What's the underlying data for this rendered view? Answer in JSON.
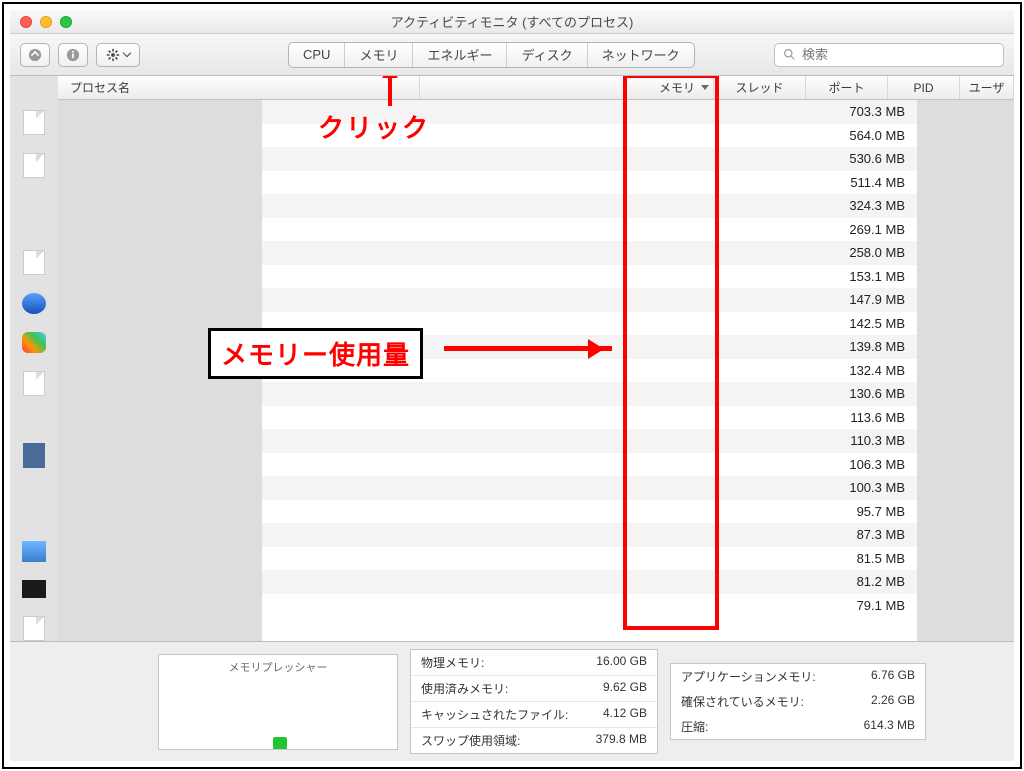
{
  "window": {
    "title": "アクティビティモニタ (すべてのプロセス)"
  },
  "toolbar": {
    "tabs": {
      "cpu": "CPU",
      "memory": "メモリ",
      "energy": "エネルギー",
      "disk": "ディスク",
      "network": "ネットワーク"
    },
    "searchPlaceholder": "検索"
  },
  "columns": {
    "process": "プロセス名",
    "memory": "メモリ",
    "threads": "スレッド",
    "ports": "ポート",
    "pid": "PID",
    "user": "ユーザ"
  },
  "annotations": {
    "click": "クリック",
    "memoryUsage": "メモリー使用量"
  },
  "memory_values": [
    "703.3 MB",
    "564.0 MB",
    "530.6 MB",
    "511.4 MB",
    "324.3 MB",
    "269.1 MB",
    "258.0 MB",
    "153.1 MB",
    "147.9 MB",
    "142.5 MB",
    "139.8 MB",
    "132.4 MB",
    "130.6 MB",
    "113.6 MB",
    "110.3 MB",
    "106.3 MB",
    "100.3 MB",
    "95.7 MB",
    "87.3 MB",
    "81.5 MB",
    "81.2 MB",
    "79.1 MB"
  ],
  "footer": {
    "pressureLabel": "メモリプレッシャー",
    "left": {
      "physicalLabel": "物理メモリ:",
      "physicalValue": "16.00 GB",
      "usedLabel": "使用済みメモリ:",
      "usedValue": "9.62 GB",
      "cachedLabel": "キャッシュされたファイル:",
      "cachedValue": "4.12 GB",
      "swapLabel": "スワップ使用領域:",
      "swapValue": "379.8 MB"
    },
    "right": {
      "appLabel": "アプリケーションメモリ:",
      "appValue": "6.76 GB",
      "wiredLabel": "確保されているメモリ:",
      "wiredValue": "2.26 GB",
      "compressedLabel": "圧縮:",
      "compressedValue": "614.3 MB"
    }
  }
}
